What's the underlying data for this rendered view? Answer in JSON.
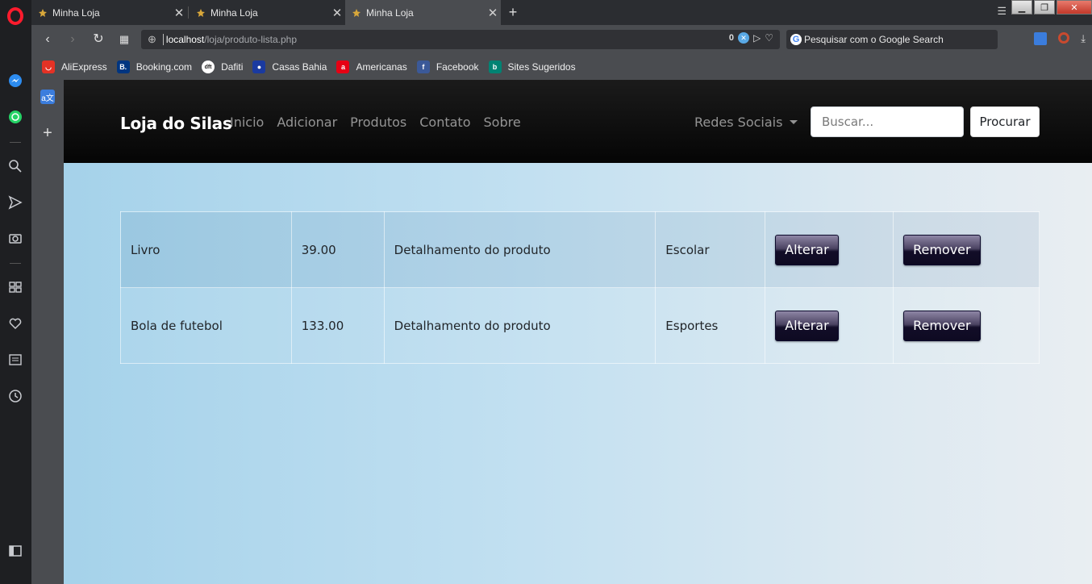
{
  "browser": {
    "tabs": [
      {
        "title": "Minha Loja",
        "active": false
      },
      {
        "title": "Minha Loja",
        "active": false
      },
      {
        "title": "Minha Loja",
        "active": true
      }
    ],
    "url_host": "localhost",
    "url_path": "/loja/produto-lista.php",
    "badge_count": "0",
    "search_placeholder": "Pesquisar com o Google Search",
    "bookmarks": [
      {
        "label": "AliExpress",
        "color": "#e43225",
        "icon": "ali-icon"
      },
      {
        "label": "Booking.com",
        "color": "#003580",
        "icon": "booking-icon"
      },
      {
        "label": "Dafiti",
        "color": "#222222",
        "icon": "dafiti-icon"
      },
      {
        "label": "Casas Bahia",
        "color": "#1a3aa0",
        "icon": "casas-bahia-icon"
      },
      {
        "label": "Americanas",
        "color": "#e60014",
        "icon": "americanas-icon"
      },
      {
        "label": "Facebook",
        "color": "#3b5998",
        "icon": "facebook-icon"
      },
      {
        "label": "Sites Sugeridos",
        "color": "#008373",
        "icon": "bing-icon"
      }
    ]
  },
  "site": {
    "brand": "Loja do Silas",
    "nav": [
      "Inicio",
      "Adicionar",
      "Produtos",
      "Contato",
      "Sobre"
    ],
    "dropdown": "Redes Sociais",
    "search_placeholder": "Buscar...",
    "search_button": "Procurar"
  },
  "products": [
    {
      "name": "Livro",
      "price": "39.00",
      "description": "Detalhamento do produto",
      "category": "Escolar",
      "edit": "Alterar",
      "remove": "Remover"
    },
    {
      "name": "Bola de futebol",
      "price": "133.00",
      "description": "Detalhamento do produto",
      "category": "Esportes",
      "edit": "Alterar",
      "remove": "Remover"
    }
  ]
}
